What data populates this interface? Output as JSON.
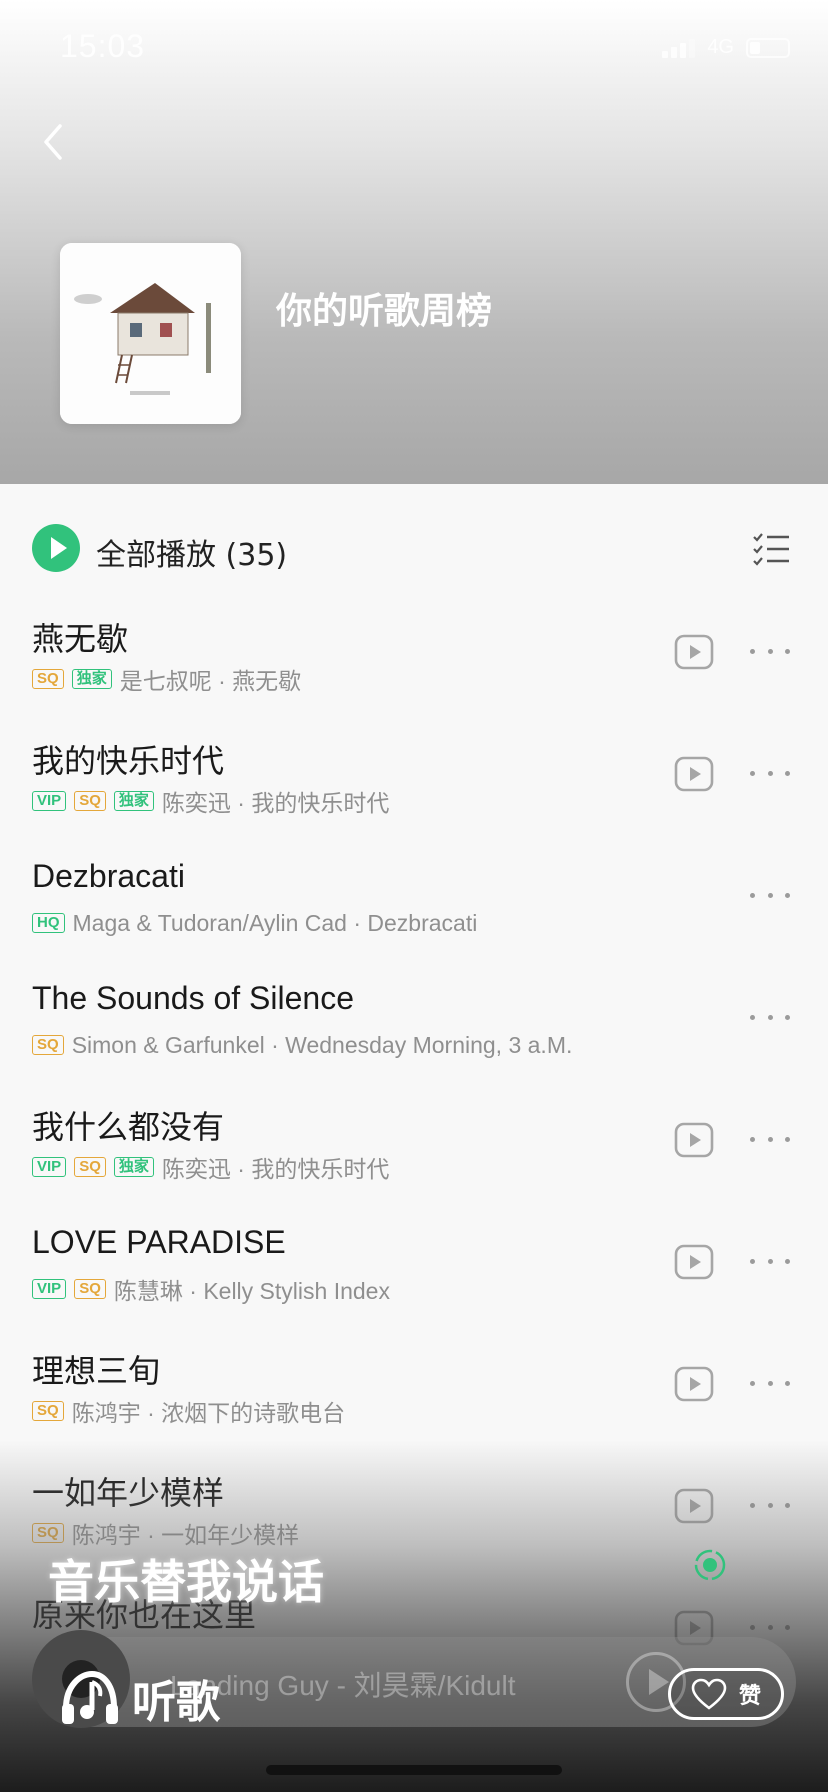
{
  "status_bar": {
    "time": "15:03",
    "network": "4G"
  },
  "header": {
    "title": "你的听歌周榜"
  },
  "play_all": {
    "label": "全部播放 (35)"
  },
  "songs": [
    {
      "title": "燕无歇",
      "tags": [
        "SQ",
        "独家"
      ],
      "meta": "是七叔呢 · 燕无歇",
      "has_mv": true
    },
    {
      "title": "我的快乐时代",
      "tags": [
        "VIP",
        "SQ",
        "独家"
      ],
      "meta": "陈奕迅 · 我的快乐时代",
      "has_mv": true
    },
    {
      "title": "Dezbracati",
      "tags": [
        "HQ"
      ],
      "meta": "Maga & Tudoran/Aylin Cad · Dezbracati",
      "has_mv": false
    },
    {
      "title": "The Sounds of Silence",
      "tags": [
        "SQ"
      ],
      "meta": "Simon & Garfunkel · Wednesday Morning, 3 a.M.",
      "has_mv": false
    },
    {
      "title": "我什么都没有",
      "tags": [
        "VIP",
        "SQ",
        "独家"
      ],
      "meta": "陈奕迅 · 我的快乐时代",
      "has_mv": true
    },
    {
      "title": "LOVE PARADISE",
      "tags": [
        "VIP",
        "SQ"
      ],
      "meta": "陈慧琳 · Kelly Stylish Index",
      "has_mv": true
    },
    {
      "title": "理想三旬",
      "tags": [
        "SQ"
      ],
      "meta": "陈鸿宇 · 浓烟下的诗歌电台",
      "has_mv": true
    },
    {
      "title": "一如年少模样",
      "tags": [
        "SQ"
      ],
      "meta": "陈鸿宇 · 一如年少模样",
      "has_mv": true
    },
    {
      "title": "原来你也在这里",
      "tags": [],
      "meta": "",
      "has_mv": true
    }
  ],
  "bottom": {
    "slogan": "音乐替我说话",
    "now_playing": "Landing Guy - 刘昊霖/Kidult",
    "like_label": "赞",
    "brand": "听歌"
  },
  "colors": {
    "accent": "#31c27c",
    "sq_tag": "#e4a73a"
  }
}
